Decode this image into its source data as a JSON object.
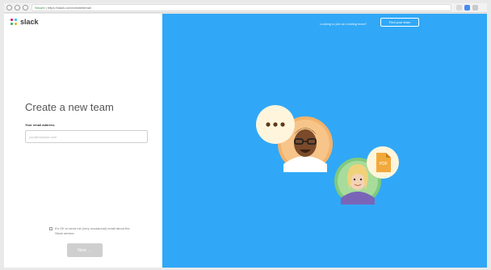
{
  "browser": {
    "url_secure": "Secure",
    "url": "https://slack.com/create#email"
  },
  "app": {
    "name": "slack"
  },
  "form": {
    "title": "Create a new team",
    "email_label": "Your email address",
    "email_placeholder": "you@example.com",
    "consent_text": "It's OK to send me (very occasional) email about the Slack service.",
    "next_label": "Next",
    "next_arrow": "→"
  },
  "header_right": {
    "prompt": "Looking to join an existing team?",
    "find_button": "Find your team"
  },
  "illustration": {
    "chat_bubble_glyph": "•••",
    "file_label": "PDF"
  }
}
